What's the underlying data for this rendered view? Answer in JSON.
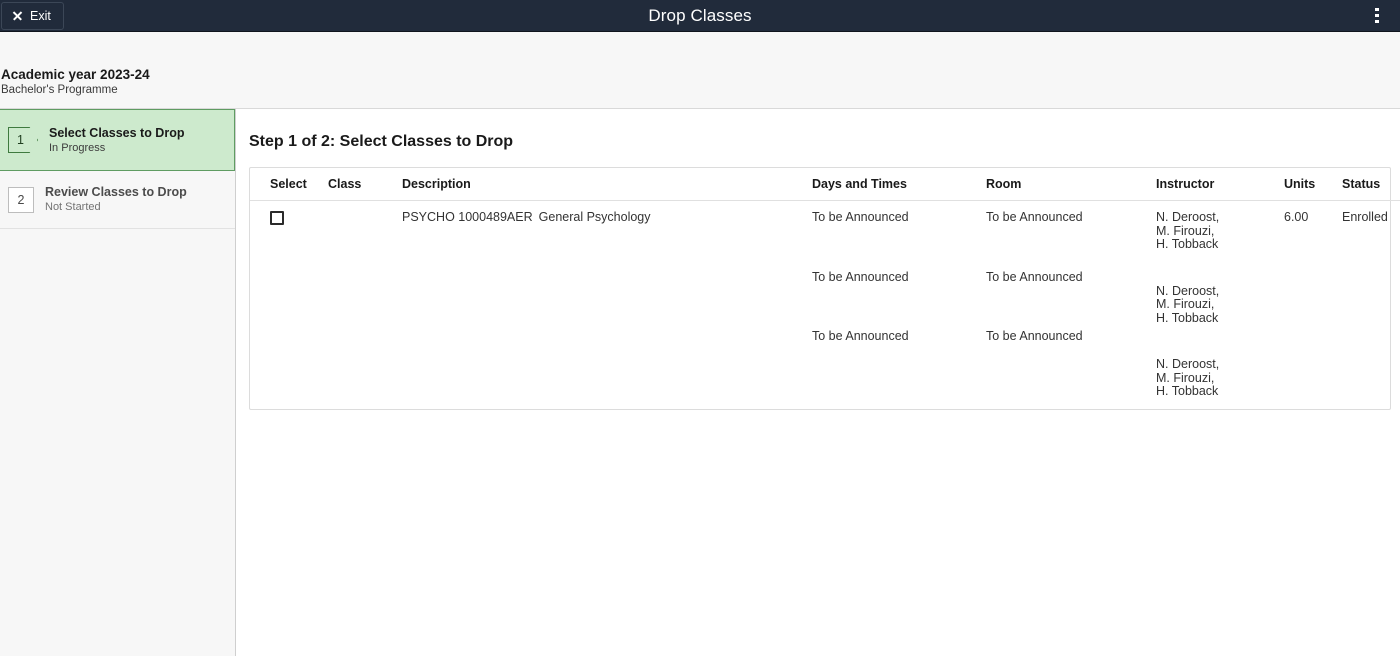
{
  "appbar": {
    "exit_label": "Exit",
    "exit_icon": "close-icon",
    "title": "Drop Classes",
    "menu_icon": "more-vertical-icon"
  },
  "subheader": {
    "year": "Academic year 2023-24",
    "programme": "Bachelor's Programme"
  },
  "sidebar": {
    "steps": [
      {
        "number": "1",
        "title": "Select Classes to Drop",
        "status": "In Progress"
      },
      {
        "number": "2",
        "title": "Review Classes to Drop",
        "status": "Not Started"
      }
    ]
  },
  "main": {
    "title": "Step 1 of 2: Select Classes to Drop",
    "table": {
      "headers": {
        "select": "Select",
        "class": "Class",
        "description": "Description",
        "days_and_times": "Days and Times",
        "room": "Room",
        "instructor": "Instructor",
        "units": "Units",
        "status": "Status"
      },
      "rows": [
        {
          "selected": false,
          "class": "",
          "description_code": "PSYCHO 1000489AER",
          "description_title": "General Psychology",
          "meetings": [
            {
              "days_and_times": "To be Announced",
              "room": "To be Announced",
              "instructors": [
                "N. Deroost,",
                "M. Firouzi,",
                "H. Tobback"
              ]
            },
            {
              "days_and_times": "To be Announced",
              "room": "To be Announced",
              "instructors": [
                "N. Deroost,",
                "M. Firouzi,",
                "H. Tobback"
              ]
            },
            {
              "days_and_times": "To be Announced",
              "room": "To be Announced",
              "instructors": [
                "N. Deroost,",
                "M. Firouzi,",
                "H. Tobback"
              ]
            }
          ],
          "units": "6.00",
          "status": "Enrolled"
        }
      ]
    }
  },
  "colors": {
    "appbar_bg": "#212b3b",
    "active_step_bg": "#cdeacd",
    "active_step_border": "#5f9c62",
    "sidebar_bg": "#f7f7f7"
  }
}
